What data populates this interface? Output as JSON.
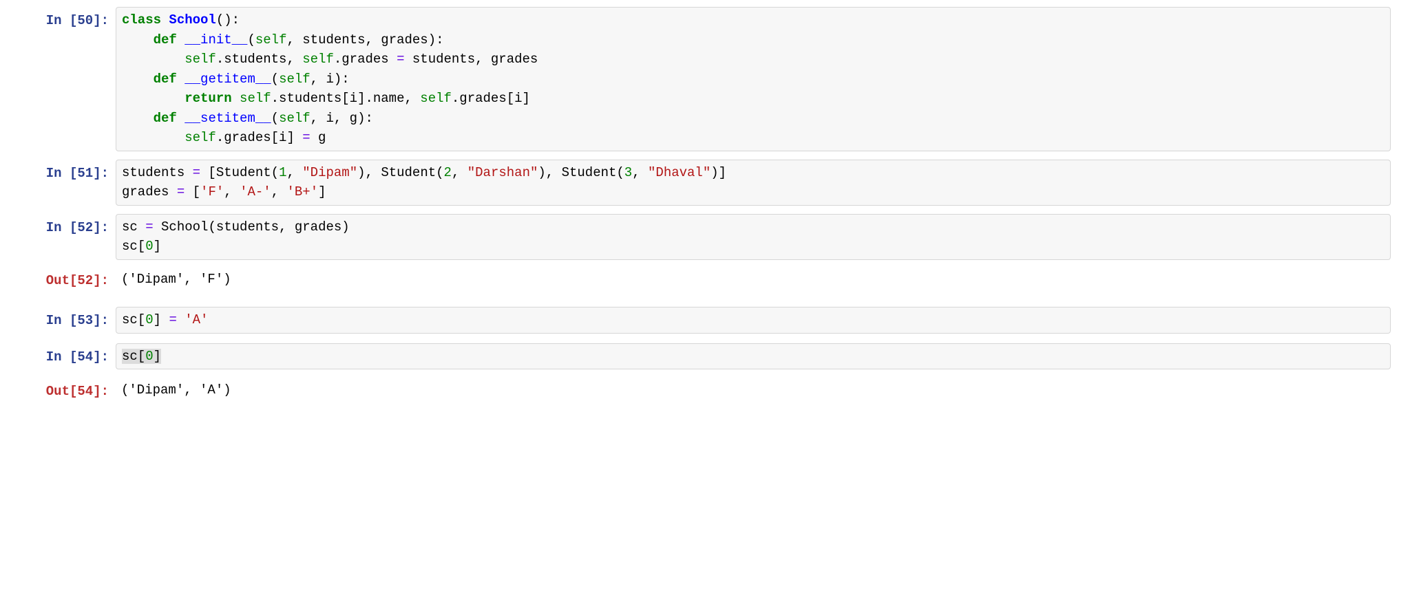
{
  "cells": [
    {
      "kind": "in",
      "prompt": "In [50]:",
      "code_html": "<span class=\"tok-kw\">class</span> <span class=\"tok-name-cl\">School</span>():\n    <span class=\"tok-kw\">def</span> <span class=\"tok-name-fn\">__init__</span>(<span class=\"tok-builtin\">self</span>, students, grades):\n        <span class=\"tok-builtin\">self</span>.students, <span class=\"tok-builtin\">self</span>.grades <span class=\"tok-op\">=</span> students, grades\n    <span class=\"tok-kw\">def</span> <span class=\"tok-name-fn\">__getitem__</span>(<span class=\"tok-builtin\">self</span>, i):\n        <span class=\"tok-kw\">return</span> <span class=\"tok-builtin\">self</span>.students[i].name, <span class=\"tok-builtin\">self</span>.grades[i]\n    <span class=\"tok-kw\">def</span> <span class=\"tok-name-fn\">__setitem__</span>(<span class=\"tok-builtin\">self</span>, i, g):\n        <span class=\"tok-builtin\">self</span>.grades[i] <span class=\"tok-op\">=</span> g"
    },
    {
      "kind": "in",
      "prompt": "In [51]:",
      "code_html": "students <span class=\"tok-op\">=</span> [Student(<span class=\"tok-num\">1</span>, <span class=\"tok-str\">\"Dipam\"</span>), Student(<span class=\"tok-num\">2</span>, <span class=\"tok-str\">\"Darshan\"</span>), Student(<span class=\"tok-num\">3</span>, <span class=\"tok-str\">\"Dhaval\"</span>)]\ngrades <span class=\"tok-op\">=</span> [<span class=\"tok-str\">'F'</span>, <span class=\"tok-str\">'A-'</span>, <span class=\"tok-str\">'B+'</span>]"
    },
    {
      "kind": "in",
      "prompt": "In [52]:",
      "code_html": "sc <span class=\"tok-op\">=</span> School(students, grades)\nsc[<span class=\"tok-num\">0</span>]"
    },
    {
      "kind": "out",
      "prompt": "Out[52]:",
      "text": "('Dipam', 'F')"
    },
    {
      "kind": "in",
      "prompt": "In [53]:",
      "code_html": "sc[<span class=\"tok-num\">0</span>] <span class=\"tok-op\">=</span> <span class=\"tok-str\">'A'</span>"
    },
    {
      "kind": "in",
      "prompt": "In [54]:",
      "code_html": "<span class=\"sel\">sc[<span class=\"tok-num\">0</span>]</span>"
    },
    {
      "kind": "out",
      "prompt": "Out[54]:",
      "text": "('Dipam', 'A')"
    }
  ]
}
